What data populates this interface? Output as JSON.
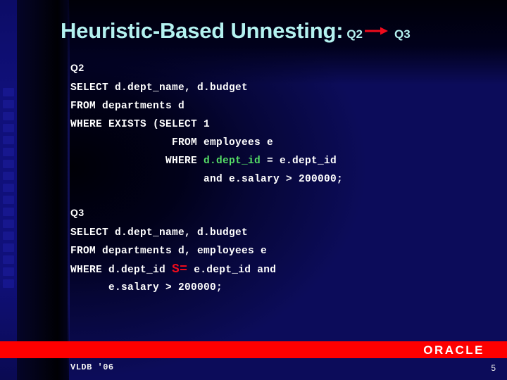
{
  "slide": {
    "title_main": "Heuristic-Based Unnesting:",
    "title_from": "Q2",
    "title_to": "Q3",
    "arrow_icon": "right-arrow-icon",
    "accent_red": "#fe0000",
    "title_color": "#b4f2f0",
    "highlight_green": "#55dd66",
    "highlight_red": "#ee0b1c"
  },
  "q2": {
    "label": "Q2",
    "lines": [
      {
        "pre": "SELECT d.dept_name, d.budget",
        "hl": "",
        "hl_kind": "",
        "post": ""
      },
      {
        "pre": "FROM departments d",
        "hl": "",
        "hl_kind": "",
        "post": ""
      },
      {
        "pre": "WHERE EXISTS (SELECT 1",
        "hl": "",
        "hl_kind": "",
        "post": ""
      },
      {
        "pre": "                FROM employees e",
        "hl": "",
        "hl_kind": "",
        "post": ""
      },
      {
        "pre": "               WHERE ",
        "hl": "d.dept_id",
        "hl_kind": "green",
        "post": " = e.dept_id"
      },
      {
        "pre": "                     and e.salary > 200000;",
        "hl": "",
        "hl_kind": "",
        "post": ""
      }
    ]
  },
  "q3": {
    "label": "Q3",
    "lines": [
      {
        "pre": "SELECT d.dept_name, d.budget",
        "hl": "",
        "hl_kind": "",
        "post": ""
      },
      {
        "pre": "FROM departments d, employees e",
        "hl": "",
        "hl_kind": "",
        "post": ""
      },
      {
        "pre": "WHERE d.dept_id ",
        "hl": "S=",
        "hl_kind": "red",
        "post": " e.dept_id and"
      },
      {
        "pre": "      e.salary > 200000;",
        "hl": "",
        "hl_kind": "",
        "post": ""
      }
    ]
  },
  "footer": {
    "conference": "VLDB '06",
    "brand": "ORACLE",
    "page_number": "5"
  }
}
